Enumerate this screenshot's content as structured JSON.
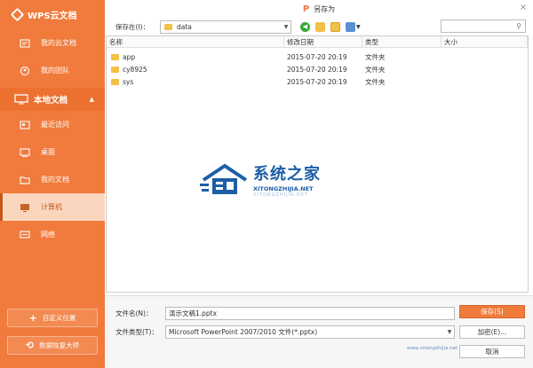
{
  "sidebar": {
    "brand": "WPS云文档",
    "cloud_items": [
      {
        "label": "我的云文档",
        "icon": "cloud-doc-icon"
      },
      {
        "label": "我的团队",
        "icon": "team-icon"
      }
    ],
    "section": {
      "label": "本地文档",
      "icon": "monitor-icon"
    },
    "local_items": [
      {
        "label": "最近访问",
        "icon": "recent-icon",
        "active": false
      },
      {
        "label": "桌面",
        "icon": "desktop-icon",
        "active": false
      },
      {
        "label": "我的文档",
        "icon": "my-docs-icon",
        "active": false
      },
      {
        "label": "计算机",
        "icon": "computer-icon",
        "active": true
      },
      {
        "label": "网络",
        "icon": "network-icon",
        "active": false
      }
    ],
    "custom_location": "自定义位置",
    "recovery": "数据恢复大师"
  },
  "dialog": {
    "title": "另存为",
    "title_icon": "P",
    "close": "×"
  },
  "toolbar": {
    "save_in_label": "保存在(I)：",
    "current_folder": "data",
    "search_icon": "search-icon"
  },
  "filelist": {
    "columns": [
      "名称",
      "修改日期",
      "类型",
      "大小"
    ],
    "rows": [
      {
        "name": "app",
        "date": "2015-07-20 20:19",
        "type": "文件夹",
        "size": ""
      },
      {
        "name": "cy8925",
        "date": "2015-07-20 20:19",
        "type": "文件夹",
        "size": ""
      },
      {
        "name": "sys",
        "date": "2015-07-20 20:19",
        "type": "文件夹",
        "size": ""
      }
    ]
  },
  "watermark": {
    "title": "系统之家",
    "sub": "XITONGZHIJIA.NET",
    "sub2": "XITONGZHIJIA.NET"
  },
  "form": {
    "filename_label": "文件名(N)：",
    "filename_value": "演示文稿1.pptx",
    "filetype_label": "文件类型(T)：",
    "filetype_value": "Microsoft PowerPoint 2007/2010 文件(*.pptx)",
    "save_button": "保存(S)",
    "mid_button": "加密(E)...",
    "cancel_button": "取消",
    "footer_link": "www.xitongzhijia.net"
  },
  "colors": {
    "accent": "#f07b3c",
    "folder": "#f2c046",
    "watermark": "#1d5ea6"
  }
}
